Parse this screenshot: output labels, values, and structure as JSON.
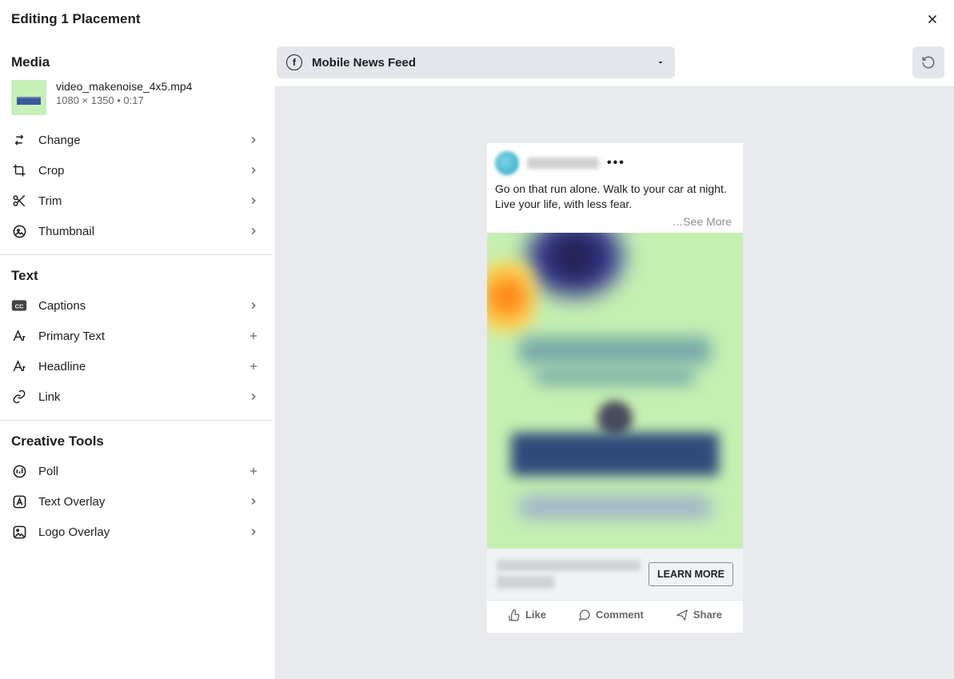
{
  "title": "Editing 1 Placement",
  "sidebar": {
    "media": {
      "section": "Media",
      "filename": "video_makenoise_4x5.mp4",
      "meta": "1080 × 1350 • 0:17",
      "items": [
        {
          "label": "Change",
          "tail": "chevron"
        },
        {
          "label": "Crop",
          "tail": "chevron"
        },
        {
          "label": "Trim",
          "tail": "chevron"
        },
        {
          "label": "Thumbnail",
          "tail": "chevron"
        }
      ]
    },
    "text": {
      "section": "Text",
      "items": [
        {
          "label": "Captions",
          "tail": "chevron"
        },
        {
          "label": "Primary Text",
          "tail": "plus"
        },
        {
          "label": "Headline",
          "tail": "plus"
        },
        {
          "label": "Link",
          "tail": "chevron"
        }
      ]
    },
    "tools": {
      "section": "Creative Tools",
      "items": [
        {
          "label": "Poll",
          "tail": "plus"
        },
        {
          "label": "Text Overlay",
          "tail": "chevron"
        },
        {
          "label": "Logo Overlay",
          "tail": "chevron"
        }
      ]
    }
  },
  "preview": {
    "placement": "Mobile News Feed",
    "post_text": "Go on that run alone. Walk to your car at night. Live your life, with less fear.",
    "see_more": "…See More",
    "cta": "LEARN MORE",
    "engage": {
      "like": "Like",
      "comment": "Comment",
      "share": "Share"
    }
  }
}
